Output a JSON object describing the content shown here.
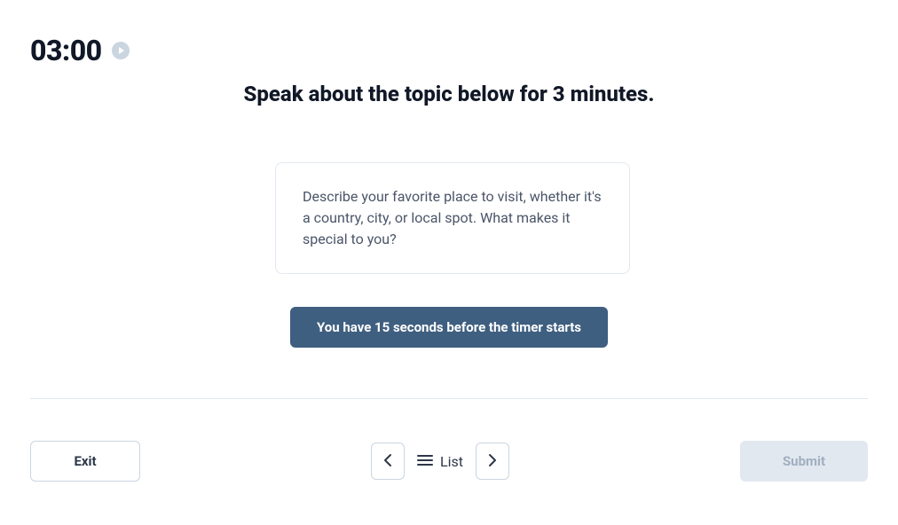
{
  "timer": {
    "value": "03:00"
  },
  "instruction": "Speak about the topic below for 3 minutes.",
  "topic": {
    "text": "Describe your favorite place to visit, whether it's a country, city, or local spot. What makes it special to you?"
  },
  "notice": "You have 15 seconds before the timer starts",
  "footer": {
    "exit": "Exit",
    "list": "List",
    "submit": "Submit"
  }
}
